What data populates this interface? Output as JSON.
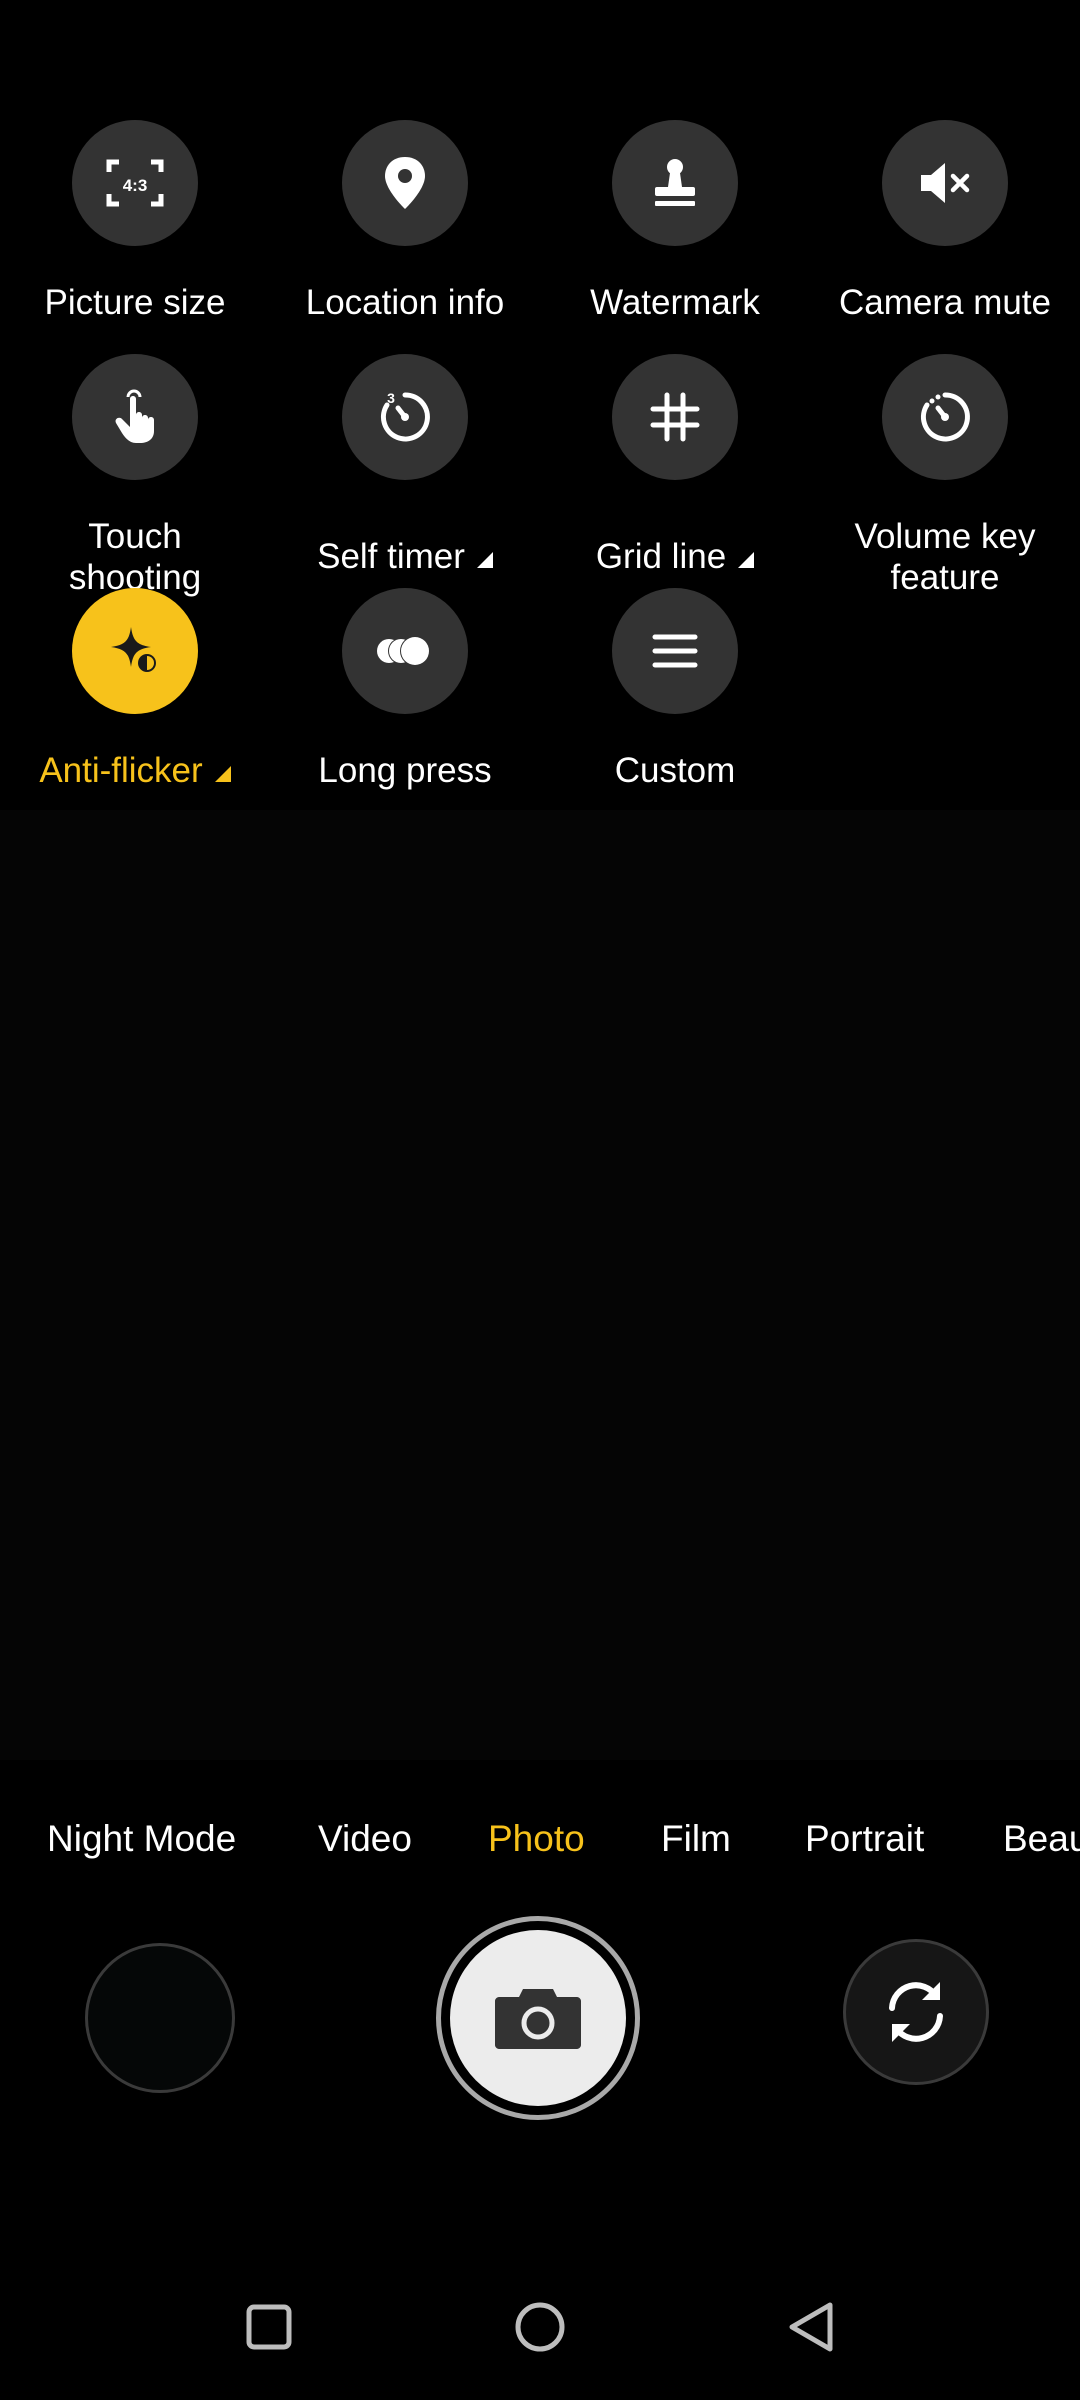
{
  "settings": {
    "items": [
      {
        "label": "Picture size",
        "icon": "aspect-ratio-icon",
        "badge": "4:3"
      },
      {
        "label": "Location info",
        "icon": "location-pin-icon"
      },
      {
        "label": "Watermark",
        "icon": "stamp-icon"
      },
      {
        "label": "Camera mute",
        "icon": "speaker-mute-icon"
      },
      {
        "label": "Touch shooting",
        "icon": "touch-hand-icon"
      },
      {
        "label": "Self timer",
        "icon": "timer-icon",
        "badge": "3",
        "has_dropdown": true
      },
      {
        "label": "Grid line",
        "icon": "grid-icon",
        "has_dropdown": true
      },
      {
        "label": "Volume key feature",
        "icon": "volume-key-timer-icon"
      },
      {
        "label": "Anti-flicker",
        "icon": "sparkle-icon",
        "has_dropdown": true,
        "active": true
      },
      {
        "label": "Long press",
        "icon": "burst-circles-icon"
      },
      {
        "label": "Custom",
        "icon": "menu-lines-icon"
      }
    ]
  },
  "modes": {
    "items": [
      "Night Mode",
      "Video",
      "Photo",
      "Film",
      "Portrait",
      "Beau"
    ],
    "selected": "Photo"
  },
  "controls": {
    "gallery_icon": "gallery-thumbnail",
    "shutter_icon": "camera-icon",
    "switch_icon": "switch-camera-icon"
  },
  "navbar": {
    "icons": [
      "recents-square-icon",
      "home-circle-icon",
      "back-triangle-icon"
    ]
  },
  "colors": {
    "accent": "#f7c21b",
    "button_bg": "#333333",
    "background": "#000000"
  }
}
